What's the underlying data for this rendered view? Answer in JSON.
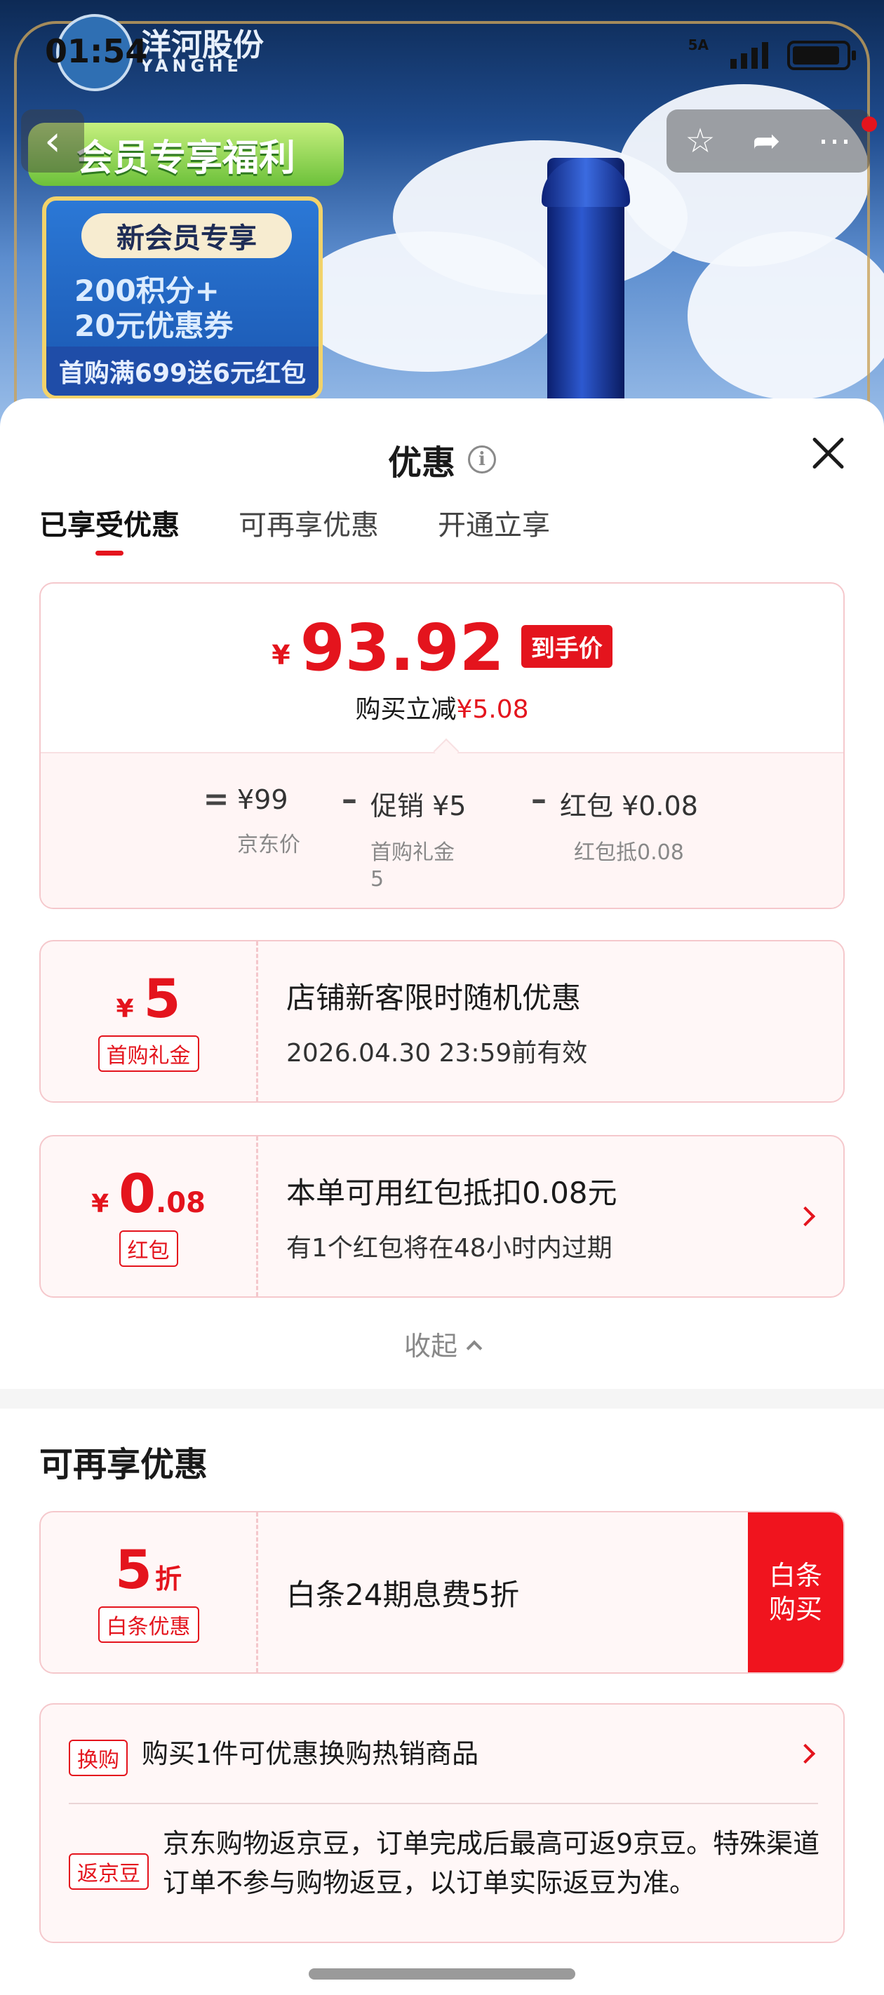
{
  "status_bar": {
    "time": "01:54",
    "network": "5A"
  },
  "banner": {
    "brand": "洋河股份",
    "brand_en": "YANGHE",
    "promo_title": "会员专享福利",
    "promo_pill": "新会员专享",
    "promo_line1": "200积分+",
    "promo_line2": "20元优惠券",
    "promo_footer": "首购满699送6元红包"
  },
  "sheet": {
    "title": "优惠",
    "tabs": [
      {
        "label": "已享受优惠",
        "active": true
      },
      {
        "label": "可再享优惠",
        "active": false
      },
      {
        "label": "开通立享",
        "active": false
      }
    ],
    "summary": {
      "currency": "¥",
      "final_price": "93.92",
      "final_tag": "到手价",
      "reduction_prefix": "购买立减",
      "reduction_amount": "¥5.08",
      "formula": {
        "eq": "=",
        "minus": "–",
        "items": [
          {
            "value": "¥99",
            "label": "京东价"
          },
          {
            "value": "促销 ¥5",
            "label": "首购礼金\n5"
          },
          {
            "value": "红包 ¥0.08",
            "label": "红包抵0.08"
          }
        ]
      }
    },
    "coupons": [
      {
        "currency": "¥",
        "amount": "5",
        "tag": "首购礼金",
        "title": "店铺新客限时随机优惠",
        "desc": "2026.04.30 23:59前有效"
      },
      {
        "currency": "¥",
        "amount": "0",
        "amount_dec": ".08",
        "tag": "红包",
        "title": "本单可用红包抵扣0.08元",
        "desc": "有1个红包将在48小时内过期"
      }
    ],
    "collapse_label": "收起",
    "more_section": {
      "title": "可再享优惠",
      "baitiao": {
        "amount": "5",
        "unit": "折",
        "tag": "白条优惠",
        "title": "白条24期息费5折",
        "button": "白条购买"
      },
      "extras": [
        {
          "tag": "换购",
          "text": "购买1件可优惠换购热销商品"
        },
        {
          "tag": "返京豆",
          "text": "京东购物返京豆，订单完成后最高可返9京豆。特殊渠道订单不参与购物返豆，以订单实际返豆为准。"
        }
      ]
    }
  },
  "colors": {
    "accent_red": "#e4141d",
    "card_border": "#f5c8cc",
    "card_bg": "#fff7f7"
  }
}
